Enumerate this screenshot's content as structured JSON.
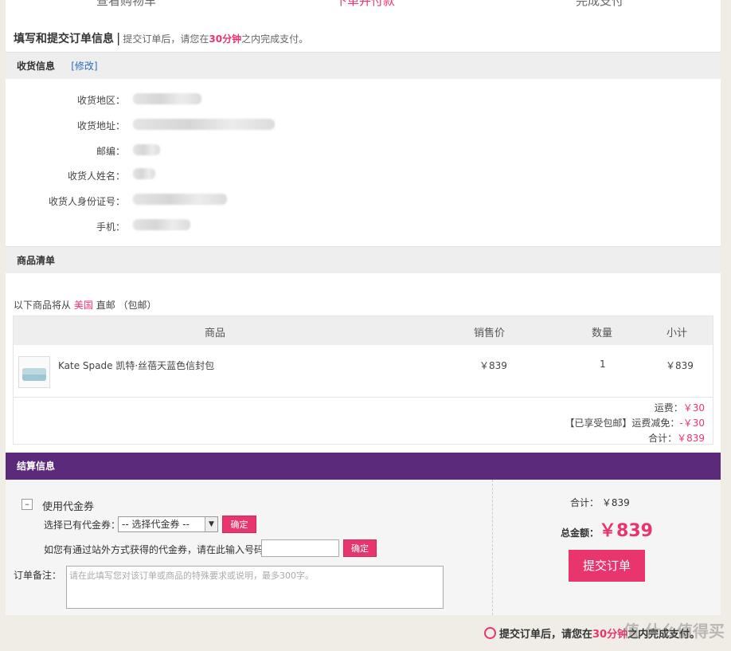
{
  "steps": [
    "查看购物车",
    "下单并付款",
    "完成支付"
  ],
  "header": {
    "title": "填写和提交订单信息",
    "separator": "|",
    "note_prefix": "提交订单后，请您在",
    "note_highlight": "30分钟",
    "note_suffix": "之内完成支付。"
  },
  "shipping": {
    "title": "收货信息",
    "edit_label": "[修改]",
    "fields": [
      "收货地区：",
      "收货地址：",
      "邮编：",
      "收货人姓名：",
      "收货人身份证号：",
      "手机："
    ]
  },
  "goods": {
    "title": "商品清单",
    "ship_note_prefix": "以下商品将从",
    "ship_note_country": "美国",
    "ship_note_mid": "直邮",
    "ship_note_suffix": "（包邮）",
    "columns": [
      "商品",
      "销售价",
      "数量",
      "小计"
    ],
    "item": {
      "name": "Kate Spade 凯特·丝蓓天蓝色信封包",
      "price": "￥839",
      "qty": "1",
      "subtotal": "￥839"
    },
    "shipping_fee_label": "运费：",
    "shipping_fee": "￥30",
    "discount_label": "【已享受包邮】运费减免：",
    "discount": "-￥30",
    "total_label": "合计：",
    "total": "￥839"
  },
  "checkout": {
    "title": "结算信息",
    "collapse_symbol": "–",
    "coupon_title": "使用代金券",
    "select_label": "选择已有代金券：",
    "select_value": "-- 选择代金券 --",
    "confirm_label": "确定",
    "code_label": "如您有通过站外方式获得的代金券，请在此输入号码：",
    "remark_label": "订单备注：",
    "remark_placeholder": "请在此填写您对该订单或商品的特殊要求或说明，最多300字。",
    "sum_label": "合计：",
    "sum_value": "￥839",
    "total_label": "总金额：",
    "total_value": "￥839",
    "submit_label": "提交订单"
  },
  "footer": {
    "note_prefix": "提交订单后，请您在",
    "note_highlight": "30分钟",
    "note_suffix": "之内完成支付。",
    "watermark": "值 什么值得买"
  },
  "colors": {
    "accent": "#e8356d",
    "checkout_bar": "#5c2a7b",
    "link": "#2a6ebb"
  }
}
